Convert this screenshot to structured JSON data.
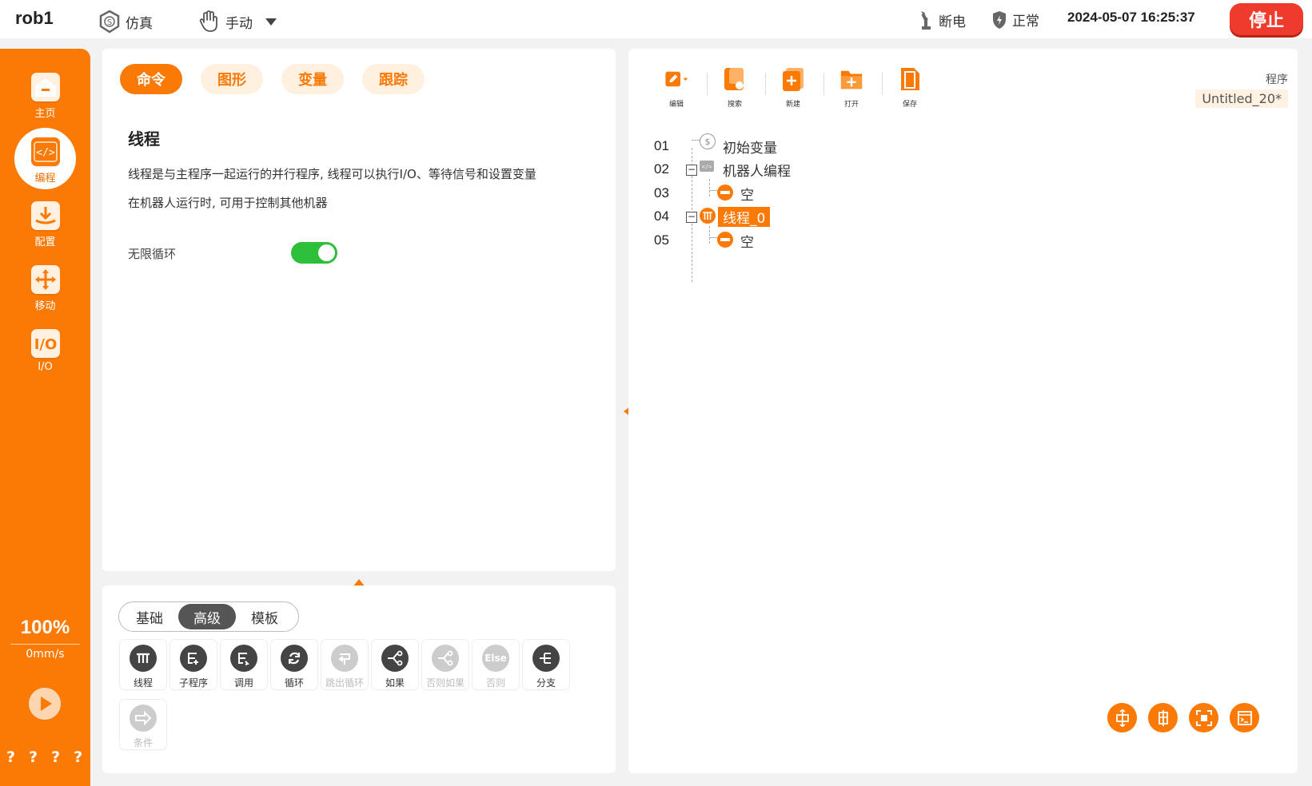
{
  "topbar": {
    "robot_name": "rob1",
    "mode_sim": "仿真",
    "mode_manual": "手动",
    "power": "断电",
    "status": "正常",
    "datetime": "2024-05-07 16:25:37",
    "stop_label": "停止"
  },
  "sidebar": {
    "items": [
      {
        "label": "主页",
        "icon": "home-icon"
      },
      {
        "label": "编程",
        "icon": "code-icon",
        "active": true
      },
      {
        "label": "配置",
        "icon": "config-icon"
      },
      {
        "label": "移动",
        "icon": "move-icon"
      },
      {
        "label": "I/O",
        "icon": "io-icon"
      }
    ],
    "speed_percent": "100%",
    "speed_value": "0mm/s",
    "help": [
      "?",
      "?",
      "?",
      "?"
    ]
  },
  "left_top": {
    "tabs": [
      "命令",
      "图形",
      "变量",
      "跟踪"
    ],
    "active_tab": "命令",
    "title": "线程",
    "desc_line1": "线程是与主程序一起运行的并行程序, 线程可以执行I/O、等待信号和设置变量",
    "desc_line2": "在机器人运行时, 可用于控制其他机器",
    "loop_label": "无限循环",
    "loop_enabled": true
  },
  "left_bottom": {
    "segments": [
      "基础",
      "高级",
      "模板"
    ],
    "active_segment": "高级",
    "commands": [
      {
        "label": "线程",
        "icon": "thread-icon",
        "enabled": true
      },
      {
        "label": "子程序",
        "icon": "subprogram-icon",
        "enabled": true
      },
      {
        "label": "调用",
        "icon": "call-icon",
        "enabled": true
      },
      {
        "label": "循环",
        "icon": "loop-icon",
        "enabled": true
      },
      {
        "label": "跳出循环",
        "icon": "break-loop-icon",
        "enabled": false
      },
      {
        "label": "如果",
        "icon": "if-icon",
        "enabled": true
      },
      {
        "label": "否则如果",
        "icon": "else-if-icon",
        "enabled": false
      },
      {
        "label": "否则",
        "icon": "else-icon",
        "enabled": false
      },
      {
        "label": "分支",
        "icon": "branch-icon",
        "enabled": true
      },
      {
        "label": "条件",
        "icon": "condition-icon",
        "enabled": false
      }
    ],
    "else_icon_text": "Else"
  },
  "right": {
    "toolbar": [
      {
        "label": "编辑",
        "icon": "edit-icon"
      },
      {
        "label": "搜索",
        "icon": "search-icon"
      },
      {
        "label": "新建",
        "icon": "new-file-icon"
      },
      {
        "label": "打开",
        "icon": "open-folder-icon"
      },
      {
        "label": "保存",
        "icon": "save-icon"
      }
    ],
    "program_label": "程序",
    "program_name": "Untitled_20*",
    "tree": [
      {
        "no": "01",
        "label": "初始变量"
      },
      {
        "no": "02",
        "label": "机器人编程"
      },
      {
        "no": "03",
        "label": "空"
      },
      {
        "no": "04",
        "label": "线程_0",
        "selected": true
      },
      {
        "no": "05",
        "label": "空"
      }
    ],
    "fabs": [
      "expand-horizontal-icon",
      "expand-vertical-icon",
      "fit-view-icon",
      "terminal-icon"
    ]
  },
  "colors": {
    "accent": "#fb7a05",
    "stop": "#ee3b2d",
    "toggle_on": "#2dbf3a"
  }
}
